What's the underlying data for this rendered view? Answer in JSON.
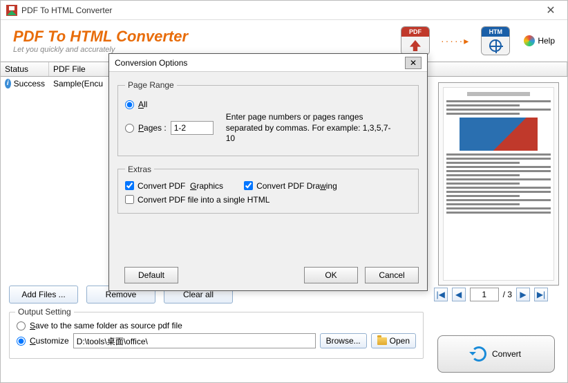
{
  "window": {
    "title": "PDF To HTML Converter",
    "close": "✕"
  },
  "header": {
    "brand_title": "PDF To HTML Converter",
    "brand_sub": "Let you quickly and accurately",
    "pdf_badge": "PDF",
    "htm_badge": "HTM",
    "help": "Help"
  },
  "grid": {
    "col_status": "Status",
    "col_file": "PDF File",
    "rows": [
      {
        "status": "Success",
        "file": "Sample(Encu"
      }
    ]
  },
  "buttons": {
    "add_files": "Add Files ...",
    "remove": "Remove",
    "clear_all": "Clear all"
  },
  "pager": {
    "current": "1",
    "total": "/ 3",
    "first": "|◀",
    "prev": "◀",
    "next": "▶",
    "last": "▶|"
  },
  "output": {
    "legend": "Output Setting",
    "save_same": "Save to the same folder as source pdf file",
    "customize": "Customize",
    "path": "D:\\tools\\桌面\\office\\",
    "browse": "Browse...",
    "open": "Open"
  },
  "convert": "Convert",
  "modal": {
    "title": "Conversion Options",
    "close": "✕",
    "page_range": {
      "legend": "Page Range",
      "all": "All",
      "pages_prefix": "Pages :",
      "pages_value": "1-2",
      "hint": "Enter page numbers or pages ranges separated by commas. For example: 1,3,5,7-10"
    },
    "extras": {
      "legend": "Extras",
      "graphics": "Convert PDF  Graphics",
      "drawing": "Convert PDF Drawing",
      "single_html": "Convert PDF file into a single HTML"
    },
    "default_btn": "Default",
    "ok": "OK",
    "cancel": "Cancel"
  }
}
